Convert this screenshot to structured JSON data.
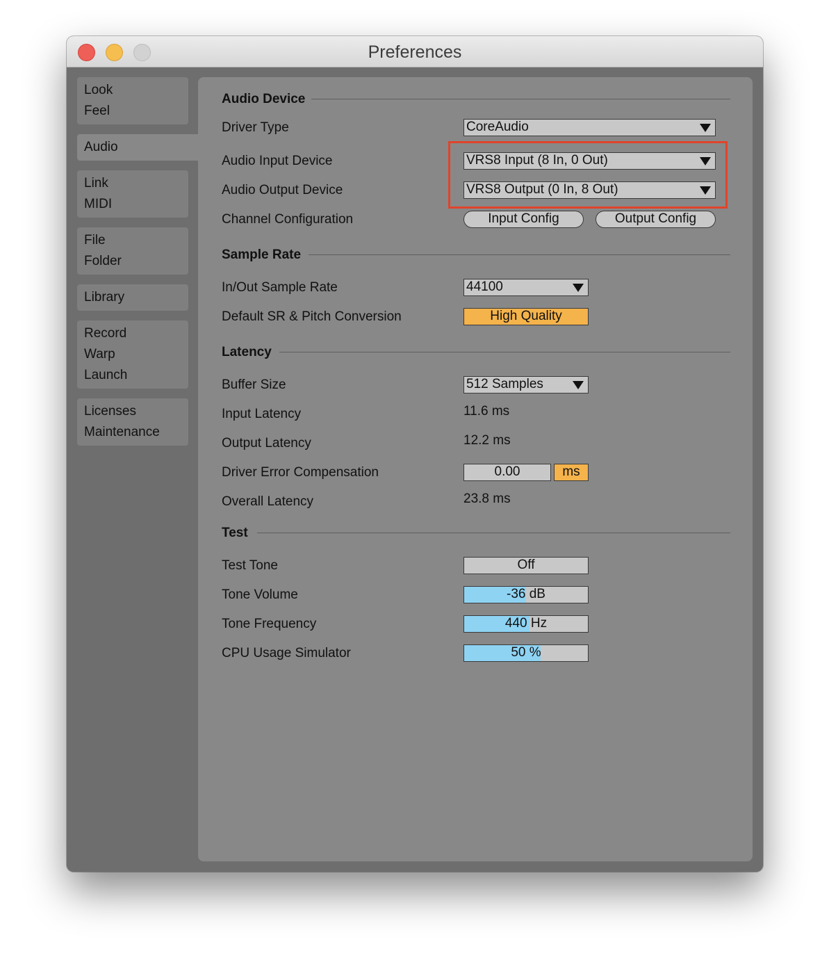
{
  "window": {
    "title": "Preferences"
  },
  "sidebar": {
    "groups": [
      [
        "Look",
        "Feel"
      ],
      [
        "Audio"
      ],
      [
        "Link",
        "MIDI"
      ],
      [
        "File",
        "Folder"
      ],
      [
        "Library"
      ],
      [
        "Record",
        "Warp",
        "Launch"
      ],
      [
        "Licenses",
        "Maintenance"
      ]
    ]
  },
  "audio_device": {
    "section": "Audio Device",
    "driver_type": {
      "label": "Driver Type",
      "value": "CoreAudio"
    },
    "input_device": {
      "label": "Audio Input Device",
      "value": "VRS8 Input (8 In, 0 Out)"
    },
    "output_device": {
      "label": "Audio Output Device",
      "value": "VRS8 Output (0 In, 8 Out)"
    },
    "channel_config": {
      "label": "Channel Configuration",
      "input_button": "Input Config",
      "output_button": "Output Config"
    }
  },
  "sample_rate": {
    "section": "Sample Rate",
    "in_out": {
      "label": "In/Out Sample Rate",
      "value": "44100"
    },
    "conversion": {
      "label": "Default SR & Pitch Conversion",
      "value": "High Quality"
    }
  },
  "latency": {
    "section": "Latency",
    "buffer": {
      "label": "Buffer Size",
      "value": "512 Samples"
    },
    "input": {
      "label": "Input Latency",
      "value": "11.6 ms"
    },
    "output": {
      "label": "Output Latency",
      "value": "12.2 ms"
    },
    "compensation": {
      "label": "Driver Error Compensation",
      "value": "0.00",
      "unit": "ms"
    },
    "overall": {
      "label": "Overall Latency",
      "value": "23.8 ms"
    }
  },
  "test": {
    "section": "Test",
    "tone": {
      "label": "Test Tone",
      "value": "Off"
    },
    "volume": {
      "label": "Tone Volume",
      "value": "-36 dB",
      "fill": 0.5
    },
    "frequency": {
      "label": "Tone Frequency",
      "value": "440 Hz",
      "fill": 0.53
    },
    "cpu": {
      "label": "CPU Usage Simulator",
      "value": "50 %",
      "fill": 0.62
    }
  },
  "colors": {
    "highlight": "#e0442b",
    "accent_orange": "#f5b34b",
    "slider_blue": "#8fd3f3"
  }
}
